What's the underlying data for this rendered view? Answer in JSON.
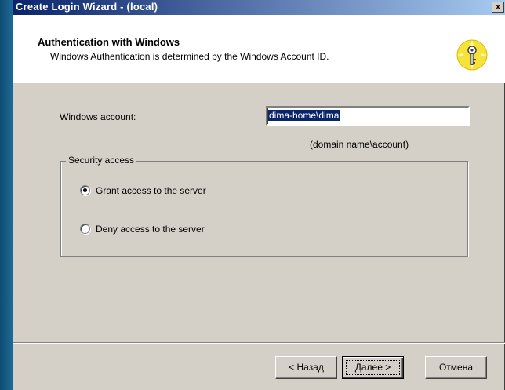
{
  "window": {
    "title": "Create Login Wizard - (local)",
    "close_glyph": "x"
  },
  "header": {
    "title": "Authentication with Windows",
    "subtitle": "Windows Authentication is determined by the Windows Account ID.",
    "icon": "key-icon"
  },
  "form": {
    "account_label": "Windows account:",
    "account_value": "dima-home\\dima",
    "account_hint": "(domain name\\account)"
  },
  "security": {
    "legend": "Security access",
    "options": [
      {
        "label": "Grant access to the server",
        "selected": true
      },
      {
        "label": "Deny access to the server",
        "selected": false
      }
    ]
  },
  "buttons": {
    "back": "< Назад",
    "next": "Далее >",
    "cancel": "Отмена"
  }
}
